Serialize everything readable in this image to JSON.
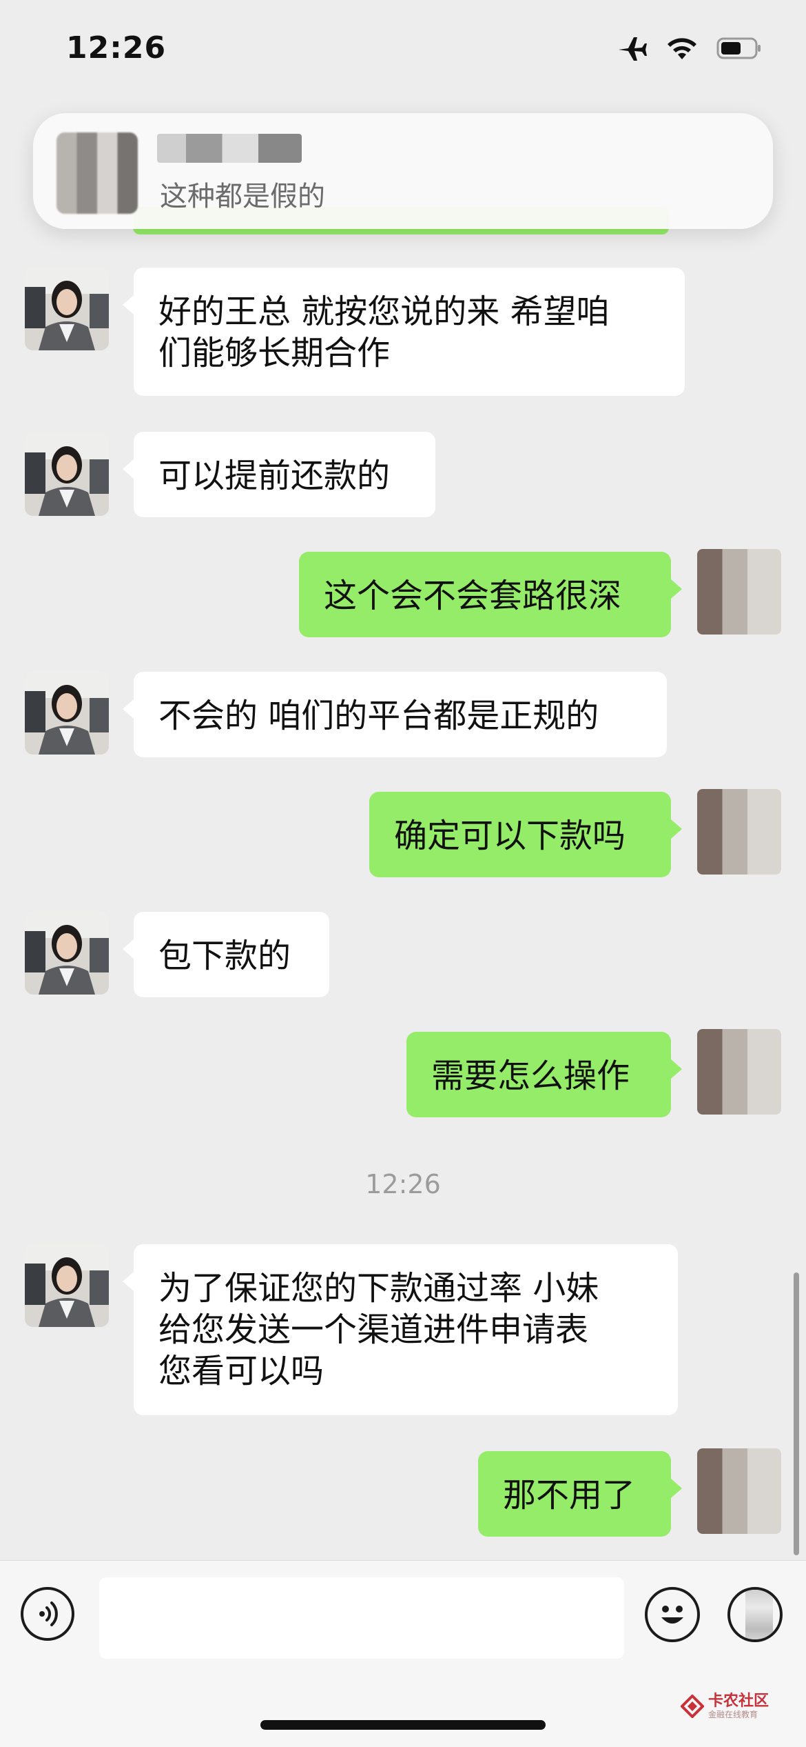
{
  "status_bar": {
    "time": "12:26",
    "icons": [
      "airplane-icon",
      "wifi-icon",
      "battery-icon"
    ]
  },
  "notification": {
    "preview_text": "这种都是假的"
  },
  "messages": [
    {
      "side": "left",
      "text_lines": [
        "好的王总  就按您说的来  希望咱",
        "们能够长期合作"
      ]
    },
    {
      "side": "left",
      "text_lines": [
        "可以提前还款的"
      ]
    },
    {
      "side": "right",
      "text_lines": [
        "这个会不会套路很深"
      ]
    },
    {
      "side": "left",
      "text_lines": [
        "不会的  咱们的平台都是正规的"
      ]
    },
    {
      "side": "right",
      "text_lines": [
        "确定可以下款吗"
      ]
    },
    {
      "side": "left",
      "text_lines": [
        "包下款的"
      ]
    },
    {
      "side": "right",
      "text_lines": [
        "需要怎么操作"
      ]
    },
    {
      "side": "left",
      "text_lines": [
        "为了保证您的下款通过率   小妹",
        "给您发送一个渠道进件申请表",
        "您看可以吗"
      ]
    },
    {
      "side": "right",
      "text_lines": [
        "那不用了"
      ]
    }
  ],
  "timestamp": "12:26",
  "watermark": {
    "title": "卡农社区",
    "subtitle": "金融在线教育"
  },
  "colors": {
    "background": "#ededed",
    "bubble_right": "#95ec69",
    "bubble_left": "#ffffff"
  }
}
